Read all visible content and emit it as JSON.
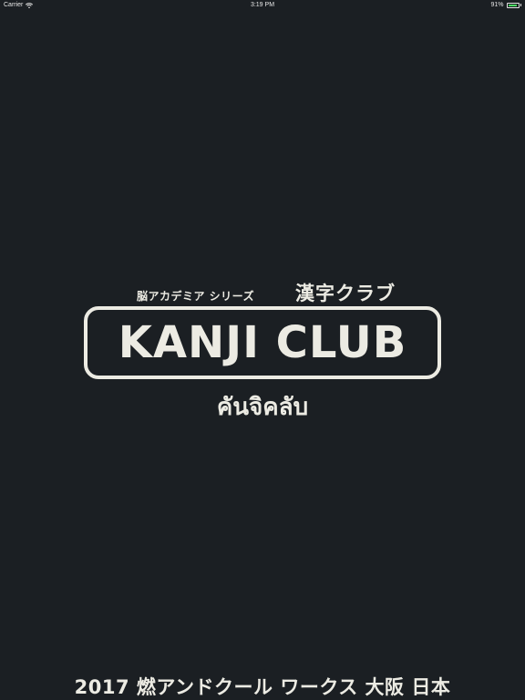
{
  "status_bar": {
    "carrier": "Carrier",
    "time": "3:19 PM",
    "battery_percent": "91%",
    "battery_level": 0.91,
    "battery_color": "#4cd964",
    "wifi_icon": "wifi-icon",
    "battery_icon": "battery-icon"
  },
  "logo": {
    "series": "脳アカデミア シリーズ",
    "name_jp": "漢字クラブ",
    "title": "KANJI CLUB",
    "name_th": "คันจิคลับ"
  },
  "footer": {
    "credit": "2017 燃アンドクール ワークス 大阪 日本"
  },
  "colors": {
    "background": "#1b1f23",
    "foreground": "#ecebe3"
  }
}
